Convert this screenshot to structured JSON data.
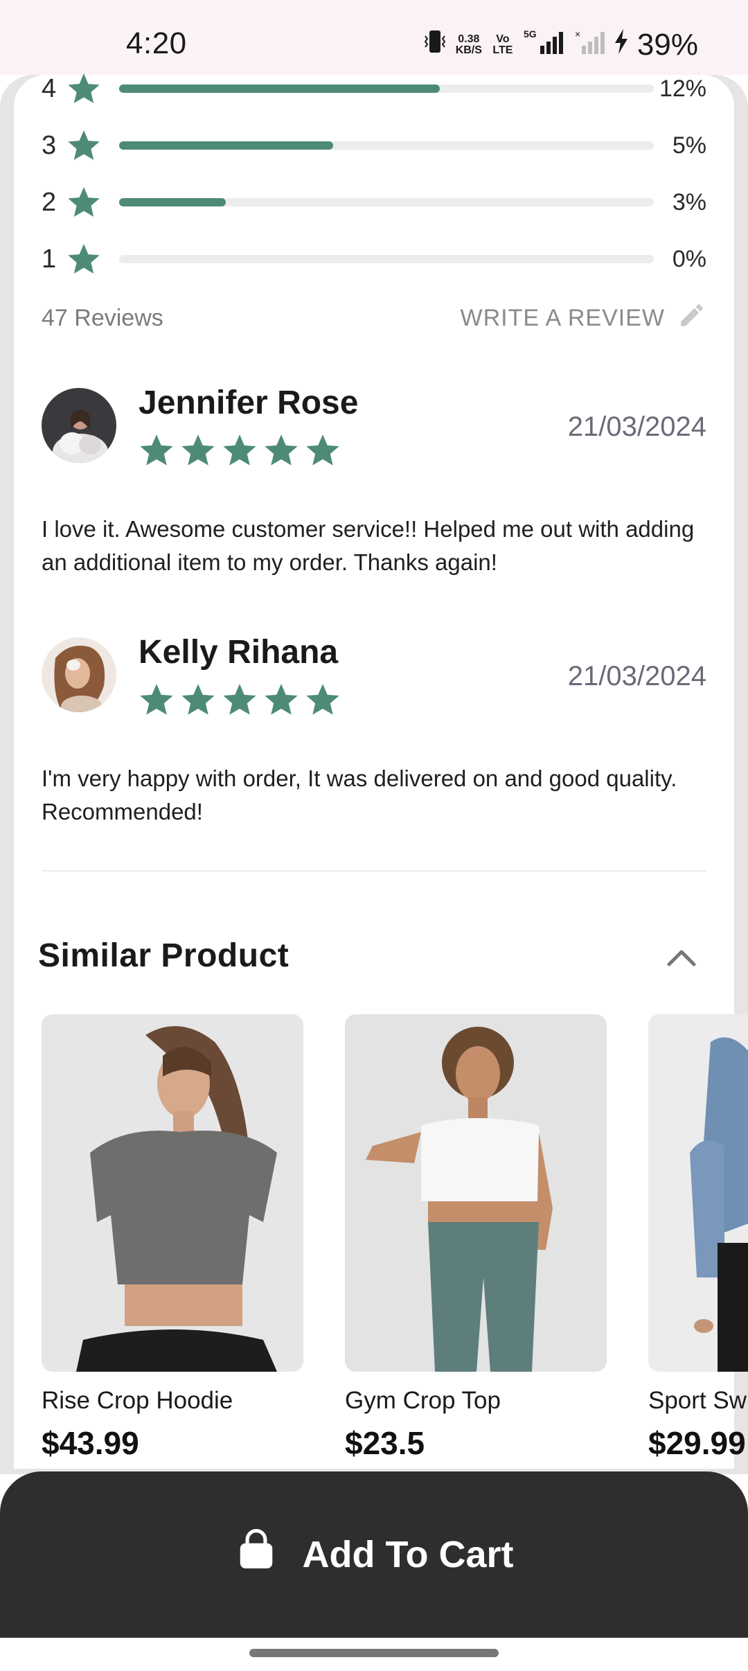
{
  "status_bar": {
    "time": "4:20",
    "net_speed_value": "0.38",
    "net_speed_unit": "KB/S",
    "volte": "Vo LTE",
    "network": "5G",
    "battery": "39%"
  },
  "ratings": [
    {
      "stars": "4",
      "percent": "12%",
      "fill": 0.6
    },
    {
      "stars": "3",
      "percent": "5%",
      "fill": 0.4
    },
    {
      "stars": "2",
      "percent": "3%",
      "fill": 0.2
    },
    {
      "stars": "1",
      "percent": "0%",
      "fill": 0.0
    }
  ],
  "reviews_summary": {
    "count_label": "47 Reviews",
    "write_label": "WRITE A REVIEW"
  },
  "reviews": [
    {
      "name": "Jennifer Rose",
      "date": "21/03/2024",
      "rating": 5,
      "text": "I love it.  Awesome customer service!! Helped me out with adding an additional item to my order. Thanks again!"
    },
    {
      "name": "Kelly Rihana",
      "date": "21/03/2024",
      "rating": 5,
      "text": "I'm very happy with order, It was delivered on and good quality. Recommended!"
    }
  ],
  "similar": {
    "title": "Similar Product",
    "products": [
      {
        "name": "Rise Crop Hoodie",
        "price": "$43.99"
      },
      {
        "name": "Gym Crop Top",
        "price": "$23.5"
      },
      {
        "name": "Sport Sw",
        "price": "$29.99"
      }
    ]
  },
  "cart": {
    "label": "Add To Cart"
  },
  "colors": {
    "accent": "#4d8b78",
    "cart_bg": "#2e2e2e"
  }
}
